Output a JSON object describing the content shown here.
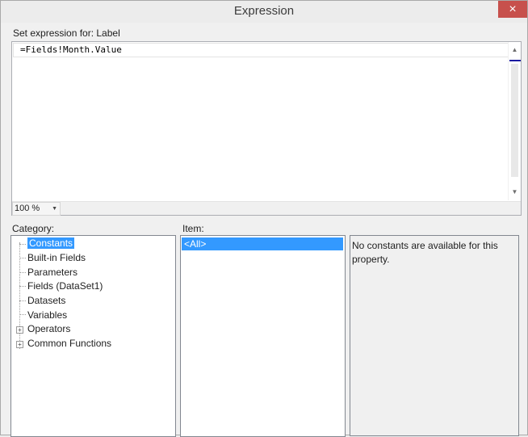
{
  "window": {
    "title": "Expression",
    "close_icon": "×"
  },
  "editor": {
    "set_label": "Set expression for: Label",
    "expression": "=Fields!Month.Value",
    "zoom": "100 %"
  },
  "category": {
    "label": "Category:",
    "items": [
      {
        "label": "Constants",
        "selected": true,
        "expandable": false
      },
      {
        "label": "Built-in Fields",
        "expandable": false
      },
      {
        "label": "Parameters",
        "expandable": false
      },
      {
        "label": "Fields (DataSet1)",
        "expandable": false
      },
      {
        "label": "Datasets",
        "expandable": false
      },
      {
        "label": "Variables",
        "expandable": false
      },
      {
        "label": "Operators",
        "expandable": true
      },
      {
        "label": "Common Functions",
        "expandable": true
      }
    ]
  },
  "item": {
    "label": "Item:",
    "items": [
      "<All>"
    ]
  },
  "description": {
    "text": "No constants are available for this property."
  },
  "colors": {
    "selection": "#3399ff",
    "close": "#c7504c"
  }
}
